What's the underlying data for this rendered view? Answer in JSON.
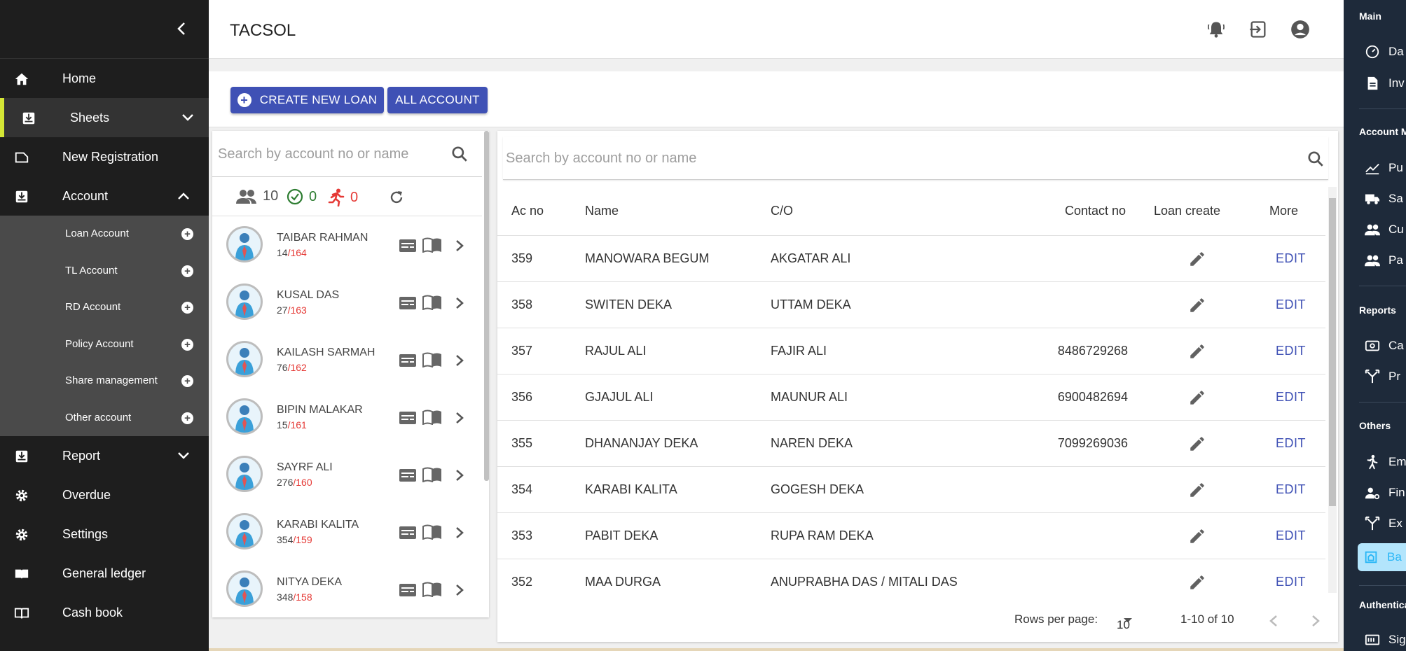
{
  "app": {
    "title": "TACSOL"
  },
  "sidebar": {
    "items": [
      {
        "label": "Home",
        "icon": "home-icon"
      },
      {
        "label": "Sheets",
        "icon": "sheets-icon",
        "active": true
      },
      {
        "label": "New Registration",
        "icon": "registration-icon"
      },
      {
        "label": "Account",
        "icon": "account-icon",
        "expanded": true
      },
      {
        "label": "Report",
        "icon": "report-icon"
      },
      {
        "label": "Overdue",
        "icon": "gear-icon"
      },
      {
        "label": "Settings",
        "icon": "gear-icon"
      },
      {
        "label": "General ledger",
        "icon": "ledger-icon"
      },
      {
        "label": "Cash book",
        "icon": "book-icon"
      }
    ],
    "account_sub": [
      "Loan Account",
      "TL Account",
      "RD Account",
      "Policy Account",
      "Share management",
      "Other account"
    ]
  },
  "actions": {
    "create_loan": "CREATE NEW LOAN",
    "all_account": "ALL ACCOUNT"
  },
  "list": {
    "search_placeholder": "Search by account no or name",
    "stats": {
      "total": "10",
      "done": "0",
      "running": "0"
    },
    "people": [
      {
        "name": "TAIBAR RAHMAN",
        "num": "14",
        "total": "/164"
      },
      {
        "name": "KUSAL DAS",
        "num": "27",
        "total": "/163"
      },
      {
        "name": "KAILASH SARMAH",
        "num": "76",
        "total": "/162"
      },
      {
        "name": "BIPIN MALAKAR",
        "num": "15",
        "total": "/161"
      },
      {
        "name": "SAYRF ALI",
        "num": "276",
        "total": "/160"
      },
      {
        "name": "KARABI KALITA",
        "num": "354",
        "total": "/159"
      },
      {
        "name": "NITYA DEKA",
        "num": "348",
        "total": "/158"
      }
    ]
  },
  "table": {
    "search_placeholder": "Search by account no or name",
    "headers": {
      "acno": "Ac no",
      "name": "Name",
      "co": "C/O",
      "contact": "Contact no",
      "loan": "Loan create",
      "more": "More"
    },
    "edit_label": "EDIT",
    "rows": [
      {
        "acno": "359",
        "name": "MANOWARA BEGUM",
        "co": "AKGATAR ALI",
        "contact": ""
      },
      {
        "acno": "358",
        "name": "SWITEN DEKA",
        "co": "UTTAM DEKA",
        "contact": ""
      },
      {
        "acno": "357",
        "name": "RAJUL ALI",
        "co": "FAJIR ALI",
        "contact": "8486729268"
      },
      {
        "acno": "356",
        "name": "GJAJUL ALI",
        "co": "MAUNUR ALI",
        "contact": "6900482694"
      },
      {
        "acno": "355",
        "name": "DHANANJAY DEKA",
        "co": "NAREN DEKA",
        "contact": "7099269036"
      },
      {
        "acno": "354",
        "name": "KARABI KALITA",
        "co": "GOGESH DEKA",
        "contact": ""
      },
      {
        "acno": "353",
        "name": "PABIT DEKA",
        "co": "RUPA RAM DEKA",
        "contact": ""
      },
      {
        "acno": "352",
        "name": "MAA DURGA",
        "co": "ANUPRABHA DAS / MITALI DAS",
        "contact": ""
      }
    ],
    "pager": {
      "rows_label": "Rows per page:",
      "rows_value": "10",
      "range": "1-10 of 10"
    }
  },
  "rightnav": {
    "sections": [
      {
        "title": "Main",
        "items": [
          {
            "label": "Da",
            "icon": "dashboard-icon"
          },
          {
            "label": "Inv",
            "icon": "invoice-icon"
          }
        ]
      },
      {
        "title": "Account M",
        "items": [
          {
            "label": "Pu",
            "icon": "chart-line-icon"
          },
          {
            "label": "Sa",
            "icon": "truck-icon"
          },
          {
            "label": "Cu",
            "icon": "customers-icon"
          },
          {
            "label": "Pa",
            "icon": "parties-icon"
          }
        ]
      },
      {
        "title": "Reports",
        "items": [
          {
            "label": "Ca",
            "icon": "cash-icon"
          },
          {
            "label": "Pr",
            "icon": "branch-icon"
          }
        ]
      },
      {
        "title": "Others",
        "items": [
          {
            "label": "Em",
            "icon": "employee-icon"
          },
          {
            "label": "Fin",
            "icon": "user-settings-icon"
          },
          {
            "label": "Ex",
            "icon": "expense-icon"
          },
          {
            "label": "Ba",
            "icon": "bank-icon",
            "selected": true
          }
        ]
      },
      {
        "title": "Authentica",
        "items": [
          {
            "label": "Sig",
            "icon": "signin-icon"
          }
        ]
      }
    ]
  },
  "colors": {
    "primary": "#3f51b5",
    "sidebar_bg": "#1e1e1e",
    "active_marker": "#d4e635",
    "accent_red": "#e53935",
    "accent_green": "#2e7d32"
  }
}
